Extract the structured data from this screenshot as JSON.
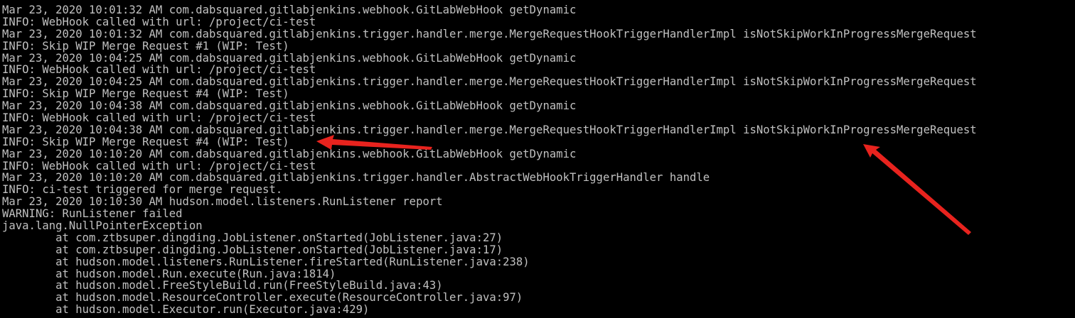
{
  "terminal": {
    "text_color": "#c0c0c0",
    "background_color": "#000000",
    "lines": [
      "Mar 23, 2020 10:01:32 AM com.dabsquared.gitlabjenkins.webhook.GitLabWebHook getDynamic",
      "INFO: WebHook called with url: /project/ci-test",
      "Mar 23, 2020 10:01:32 AM com.dabsquared.gitlabjenkins.trigger.handler.merge.MergeRequestHookTriggerHandlerImpl isNotSkipWorkInProgressMergeRequest",
      "INFO: Skip WIP Merge Request #1 (WIP: Test)",
      "Mar 23, 2020 10:04:25 AM com.dabsquared.gitlabjenkins.webhook.GitLabWebHook getDynamic",
      "INFO: WebHook called with url: /project/ci-test",
      "Mar 23, 2020 10:04:25 AM com.dabsquared.gitlabjenkins.trigger.handler.merge.MergeRequestHookTriggerHandlerImpl isNotSkipWorkInProgressMergeRequest",
      "INFO: Skip WIP Merge Request #4 (WIP: Test)",
      "Mar 23, 2020 10:04:38 AM com.dabsquared.gitlabjenkins.webhook.GitLabWebHook getDynamic",
      "INFO: WebHook called with url: /project/ci-test",
      "Mar 23, 2020 10:04:38 AM com.dabsquared.gitlabjenkins.trigger.handler.merge.MergeRequestHookTriggerHandlerImpl isNotSkipWorkInProgressMergeRequest",
      "INFO: Skip WIP Merge Request #4 (WIP: Test)",
      "Mar 23, 2020 10:10:20 AM com.dabsquared.gitlabjenkins.webhook.GitLabWebHook getDynamic",
      "INFO: WebHook called with url: /project/ci-test",
      "Mar 23, 2020 10:10:20 AM com.dabsquared.gitlabjenkins.trigger.handler.AbstractWebHookTriggerHandler handle",
      "INFO: ci-test triggered for merge request.",
      "Mar 23, 2020 10:10:30 AM hudson.model.listeners.RunListener report",
      "WARNING: RunListener failed",
      "java.lang.NullPointerException",
      "        at com.ztbsuper.dingding.JobListener.onStarted(JobListener.java:27)",
      "        at com.ztbsuper.dingding.JobListener.onStarted(JobListener.java:17)",
      "        at hudson.model.listeners.RunListener.fireStarted(RunListener.java:238)",
      "        at hudson.model.Run.execute(Run.java:1814)",
      "        at hudson.model.FreeStyleBuild.run(FreeStyleBuild.java:43)",
      "        at hudson.model.ResourceController.execute(ResourceController.java:97)",
      "        at hudson.model.Executor.run(Executor.java:429)"
    ]
  },
  "annotations": {
    "arrow_color": "#e8231e",
    "arrows": [
      {
        "icon": "red-arrow-pointing-left"
      },
      {
        "icon": "red-arrow-pointing-up-left"
      }
    ]
  }
}
